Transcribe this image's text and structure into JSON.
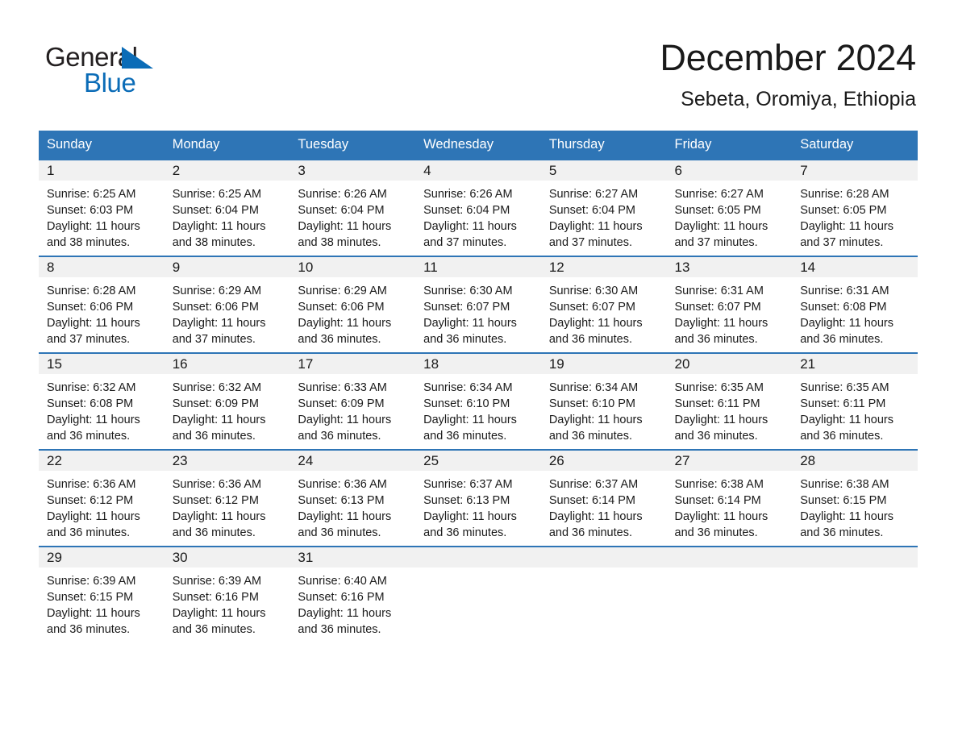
{
  "brand": {
    "name_part1": "General",
    "name_part2": "Blue",
    "accent_color": "#0b6cb7"
  },
  "header": {
    "title": "December 2024",
    "location": "Sebeta, Oromiya, Ethiopia"
  },
  "theme": {
    "header_blue": "#2e75b6",
    "band_gray": "#f1f1f1"
  },
  "weekday_headers": [
    "Sunday",
    "Monday",
    "Tuesday",
    "Wednesday",
    "Thursday",
    "Friday",
    "Saturday"
  ],
  "weeks": [
    [
      {
        "day": "1",
        "sunrise": "Sunrise: 6:25 AM",
        "sunset": "Sunset: 6:03 PM",
        "daylight_line1": "Daylight: 11 hours",
        "daylight_line2": "and 38 minutes."
      },
      {
        "day": "2",
        "sunrise": "Sunrise: 6:25 AM",
        "sunset": "Sunset: 6:04 PM",
        "daylight_line1": "Daylight: 11 hours",
        "daylight_line2": "and 38 minutes."
      },
      {
        "day": "3",
        "sunrise": "Sunrise: 6:26 AM",
        "sunset": "Sunset: 6:04 PM",
        "daylight_line1": "Daylight: 11 hours",
        "daylight_line2": "and 38 minutes."
      },
      {
        "day": "4",
        "sunrise": "Sunrise: 6:26 AM",
        "sunset": "Sunset: 6:04 PM",
        "daylight_line1": "Daylight: 11 hours",
        "daylight_line2": "and 37 minutes."
      },
      {
        "day": "5",
        "sunrise": "Sunrise: 6:27 AM",
        "sunset": "Sunset: 6:04 PM",
        "daylight_line1": "Daylight: 11 hours",
        "daylight_line2": "and 37 minutes."
      },
      {
        "day": "6",
        "sunrise": "Sunrise: 6:27 AM",
        "sunset": "Sunset: 6:05 PM",
        "daylight_line1": "Daylight: 11 hours",
        "daylight_line2": "and 37 minutes."
      },
      {
        "day": "7",
        "sunrise": "Sunrise: 6:28 AM",
        "sunset": "Sunset: 6:05 PM",
        "daylight_line1": "Daylight: 11 hours",
        "daylight_line2": "and 37 minutes."
      }
    ],
    [
      {
        "day": "8",
        "sunrise": "Sunrise: 6:28 AM",
        "sunset": "Sunset: 6:06 PM",
        "daylight_line1": "Daylight: 11 hours",
        "daylight_line2": "and 37 minutes."
      },
      {
        "day": "9",
        "sunrise": "Sunrise: 6:29 AM",
        "sunset": "Sunset: 6:06 PM",
        "daylight_line1": "Daylight: 11 hours",
        "daylight_line2": "and 37 minutes."
      },
      {
        "day": "10",
        "sunrise": "Sunrise: 6:29 AM",
        "sunset": "Sunset: 6:06 PM",
        "daylight_line1": "Daylight: 11 hours",
        "daylight_line2": "and 36 minutes."
      },
      {
        "day": "11",
        "sunrise": "Sunrise: 6:30 AM",
        "sunset": "Sunset: 6:07 PM",
        "daylight_line1": "Daylight: 11 hours",
        "daylight_line2": "and 36 minutes."
      },
      {
        "day": "12",
        "sunrise": "Sunrise: 6:30 AM",
        "sunset": "Sunset: 6:07 PM",
        "daylight_line1": "Daylight: 11 hours",
        "daylight_line2": "and 36 minutes."
      },
      {
        "day": "13",
        "sunrise": "Sunrise: 6:31 AM",
        "sunset": "Sunset: 6:07 PM",
        "daylight_line1": "Daylight: 11 hours",
        "daylight_line2": "and 36 minutes."
      },
      {
        "day": "14",
        "sunrise": "Sunrise: 6:31 AM",
        "sunset": "Sunset: 6:08 PM",
        "daylight_line1": "Daylight: 11 hours",
        "daylight_line2": "and 36 minutes."
      }
    ],
    [
      {
        "day": "15",
        "sunrise": "Sunrise: 6:32 AM",
        "sunset": "Sunset: 6:08 PM",
        "daylight_line1": "Daylight: 11 hours",
        "daylight_line2": "and 36 minutes."
      },
      {
        "day": "16",
        "sunrise": "Sunrise: 6:32 AM",
        "sunset": "Sunset: 6:09 PM",
        "daylight_line1": "Daylight: 11 hours",
        "daylight_line2": "and 36 minutes."
      },
      {
        "day": "17",
        "sunrise": "Sunrise: 6:33 AM",
        "sunset": "Sunset: 6:09 PM",
        "daylight_line1": "Daylight: 11 hours",
        "daylight_line2": "and 36 minutes."
      },
      {
        "day": "18",
        "sunrise": "Sunrise: 6:34 AM",
        "sunset": "Sunset: 6:10 PM",
        "daylight_line1": "Daylight: 11 hours",
        "daylight_line2": "and 36 minutes."
      },
      {
        "day": "19",
        "sunrise": "Sunrise: 6:34 AM",
        "sunset": "Sunset: 6:10 PM",
        "daylight_line1": "Daylight: 11 hours",
        "daylight_line2": "and 36 minutes."
      },
      {
        "day": "20",
        "sunrise": "Sunrise: 6:35 AM",
        "sunset": "Sunset: 6:11 PM",
        "daylight_line1": "Daylight: 11 hours",
        "daylight_line2": "and 36 minutes."
      },
      {
        "day": "21",
        "sunrise": "Sunrise: 6:35 AM",
        "sunset": "Sunset: 6:11 PM",
        "daylight_line1": "Daylight: 11 hours",
        "daylight_line2": "and 36 minutes."
      }
    ],
    [
      {
        "day": "22",
        "sunrise": "Sunrise: 6:36 AM",
        "sunset": "Sunset: 6:12 PM",
        "daylight_line1": "Daylight: 11 hours",
        "daylight_line2": "and 36 minutes."
      },
      {
        "day": "23",
        "sunrise": "Sunrise: 6:36 AM",
        "sunset": "Sunset: 6:12 PM",
        "daylight_line1": "Daylight: 11 hours",
        "daylight_line2": "and 36 minutes."
      },
      {
        "day": "24",
        "sunrise": "Sunrise: 6:36 AM",
        "sunset": "Sunset: 6:13 PM",
        "daylight_line1": "Daylight: 11 hours",
        "daylight_line2": "and 36 minutes."
      },
      {
        "day": "25",
        "sunrise": "Sunrise: 6:37 AM",
        "sunset": "Sunset: 6:13 PM",
        "daylight_line1": "Daylight: 11 hours",
        "daylight_line2": "and 36 minutes."
      },
      {
        "day": "26",
        "sunrise": "Sunrise: 6:37 AM",
        "sunset": "Sunset: 6:14 PM",
        "daylight_line1": "Daylight: 11 hours",
        "daylight_line2": "and 36 minutes."
      },
      {
        "day": "27",
        "sunrise": "Sunrise: 6:38 AM",
        "sunset": "Sunset: 6:14 PM",
        "daylight_line1": "Daylight: 11 hours",
        "daylight_line2": "and 36 minutes."
      },
      {
        "day": "28",
        "sunrise": "Sunrise: 6:38 AM",
        "sunset": "Sunset: 6:15 PM",
        "daylight_line1": "Daylight: 11 hours",
        "daylight_line2": "and 36 minutes."
      }
    ],
    [
      {
        "day": "29",
        "sunrise": "Sunrise: 6:39 AM",
        "sunset": "Sunset: 6:15 PM",
        "daylight_line1": "Daylight: 11 hours",
        "daylight_line2": "and 36 minutes."
      },
      {
        "day": "30",
        "sunrise": "Sunrise: 6:39 AM",
        "sunset": "Sunset: 6:16 PM",
        "daylight_line1": "Daylight: 11 hours",
        "daylight_line2": "and 36 minutes."
      },
      {
        "day": "31",
        "sunrise": "Sunrise: 6:40 AM",
        "sunset": "Sunset: 6:16 PM",
        "daylight_line1": "Daylight: 11 hours",
        "daylight_line2": "and 36 minutes."
      },
      {
        "day": "",
        "sunrise": "",
        "sunset": "",
        "daylight_line1": "",
        "daylight_line2": ""
      },
      {
        "day": "",
        "sunrise": "",
        "sunset": "",
        "daylight_line1": "",
        "daylight_line2": ""
      },
      {
        "day": "",
        "sunrise": "",
        "sunset": "",
        "daylight_line1": "",
        "daylight_line2": ""
      },
      {
        "day": "",
        "sunrise": "",
        "sunset": "",
        "daylight_line1": "",
        "daylight_line2": ""
      }
    ]
  ]
}
